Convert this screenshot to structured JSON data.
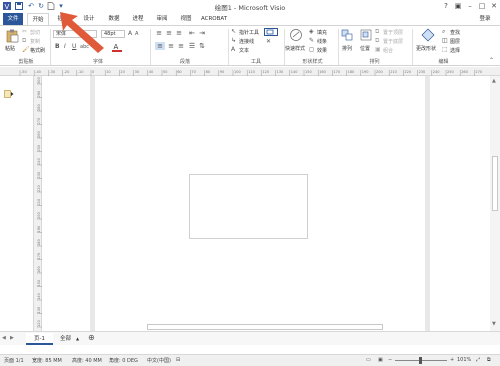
{
  "window": {
    "title": "绘图1 - Microsoft Visio",
    "qat": [
      "save-icon",
      "undo-icon",
      "redo-icon",
      "new-icon"
    ],
    "controls": [
      "help-icon",
      "restore-ribbon-icon",
      "minimize-icon",
      "maximize-icon",
      "close-icon"
    ]
  },
  "tabs": {
    "file": "文件",
    "home": "开始",
    "insert": "插入",
    "design": "设计",
    "data": "数据",
    "process": "进程",
    "review": "审阅",
    "view": "视图",
    "acrobat": "ACROBAT",
    "login": "登录"
  },
  "ribbon": {
    "clipboard": {
      "paste": "粘贴",
      "cut": "剪切",
      "copy": "复制",
      "format_painter": "格式刷",
      "label": "剪贴板"
    },
    "font": {
      "font_name": "宋体",
      "font_size": "48pt",
      "label": "字体"
    },
    "paragraph": {
      "label": "段落"
    },
    "tools": {
      "pointer": "指针工具",
      "connector": "连接线",
      "text": "文本",
      "label": "工具"
    },
    "shape_styles": {
      "quick_styles": "快速样式",
      "fill": "填充",
      "line": "线条",
      "effects": "效果",
      "label": "形状样式"
    },
    "arrange": {
      "arrange": "排列",
      "position": "位置",
      "bring_front": "置于顶层",
      "send_back": "置于底层",
      "group": "组合",
      "label": "排列"
    },
    "editing": {
      "change_shape": "更改形状",
      "find": "查找",
      "layers": "图层",
      "select": "选择",
      "label": "编辑"
    }
  },
  "ruler_marks": [
    "-50",
    "-40",
    "-30",
    "-20",
    "-10",
    "0",
    "10",
    "20",
    "30",
    "40",
    "50",
    "60",
    "70",
    "80",
    "90",
    "100",
    "110",
    "120",
    "130",
    "140",
    "150",
    "160",
    "170",
    "180",
    "190",
    "200",
    "210",
    "220",
    "230",
    "240",
    "250",
    "260",
    "270"
  ],
  "vruler_marks": [
    "300",
    "290",
    "280",
    "270",
    "260",
    "250",
    "240",
    "230",
    "220",
    "210",
    "200",
    "190",
    "180",
    "170",
    "160",
    "150",
    "140",
    "130",
    "120"
  ],
  "page_tabs": {
    "page": "页-1",
    "all": "全部"
  },
  "status": {
    "page": "页面 1/1",
    "width": "宽度: 85 MM",
    "height": "高度: 40 MM",
    "angle": "角度: 0 DEG",
    "language": "中文(中国)",
    "zoom": "101%"
  },
  "colors": {
    "file_tab": "#2b579a",
    "annotation_arrow": "#e05a3a"
  }
}
